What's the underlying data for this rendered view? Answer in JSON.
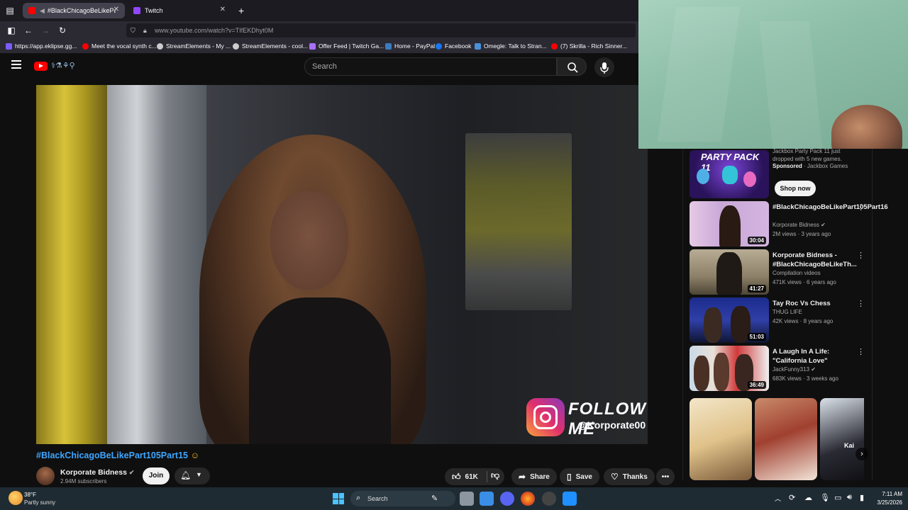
{
  "browser": {
    "tabs": [
      {
        "label": "#BlackChicagoBeLikePart10",
        "active": true
      },
      {
        "label": "Twitch",
        "active": false
      }
    ],
    "new_tab": "+",
    "url": "www.youtube.com/watch?v=TIfEKDhyt0M",
    "bookmarks": [
      "https://app.eklipse.gg...",
      "Meet the vocal synth c...",
      "StreamElements - My ...",
      "StreamElements - cool...",
      "Offer Feed | Twitch Ga...",
      "Home - PayPal",
      "Facebook",
      "Omegle: Talk to Stran...",
      "(7) Skrilla - Rich Sinner..."
    ]
  },
  "youtube": {
    "search_placeholder": "Search",
    "video": {
      "title": "#BlackChicagoBeLikePart105Part15",
      "overlay_follow": "FOLLOW ME",
      "overlay_handle": "@Korporate00"
    },
    "channel": {
      "name": "Korporate Bidness",
      "subscribers": "2.94M subscribers",
      "join_label": "Join"
    },
    "actions": {
      "likes": "61K",
      "share": "Share",
      "save": "Save",
      "thanks": "Thanks"
    },
    "sponsored": {
      "title": "Jackbox Party Pack 11 just dropped with 5 new games.",
      "badge": "Sponsored",
      "advertiser": "Jackbox Games",
      "cta": "Shop now",
      "thumb_text": "PARTY PACK 11"
    },
    "recommendations": [
      {
        "title": "#BlackChicagoBeLikePart105Part16",
        "channel": "Korporate Bidness",
        "meta": "2M views · 3 years ago",
        "duration": "30:04"
      },
      {
        "title": "Korporate Bidness - #BlackChicagoBeLikeTh...",
        "channel": "Compilation videos",
        "meta": "471K views · 6 years ago",
        "duration": "41:27"
      },
      {
        "title": "Tay Roc Vs Chess",
        "channel": "THUG LIFE",
        "meta": "42K views · 8 years ago",
        "duration": "51:03"
      },
      {
        "title": "A Laugh In A Life: \"California Love\"",
        "channel": "JackFunny313",
        "meta": "683K views · 3 weeks ago",
        "duration": "36:49"
      }
    ],
    "shorts_label": "Kai"
  },
  "taskbar": {
    "weather_temp": "38°F",
    "weather_desc": "Partly sunny",
    "search_label": "Search",
    "time": "7:11 AM",
    "date": "3/25/2026"
  },
  "colors": {
    "yt_red": "#ff0000",
    "link_blue": "#3ea6ff",
    "webcam_green": "#8ebfa8"
  }
}
